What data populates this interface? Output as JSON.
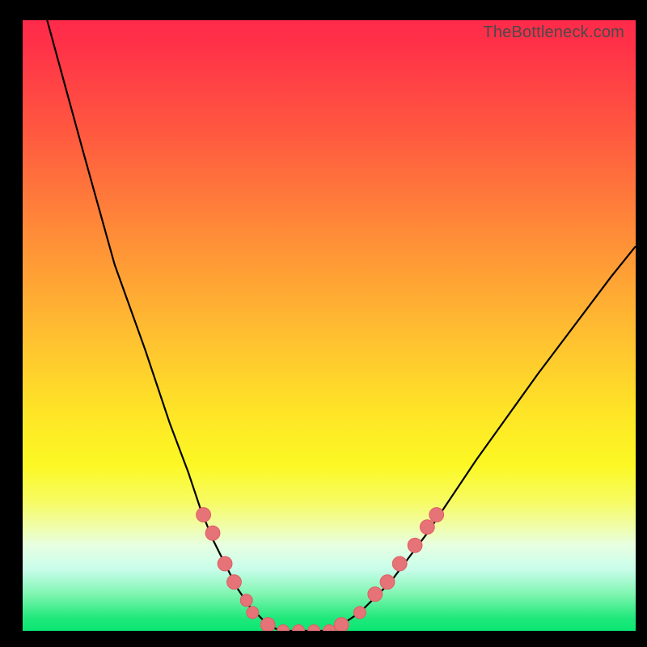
{
  "watermark": "TheBottleneck.com",
  "chart_data": {
    "type": "line",
    "title": "",
    "xlabel": "",
    "ylabel": "",
    "xlim": [
      0,
      100
    ],
    "ylim": [
      0,
      100
    ],
    "series": [
      {
        "name": "bottleneck-curve",
        "x": [
          4,
          10,
          15,
          20,
          24,
          27,
          29,
          31,
          33,
          35,
          37,
          40,
          42,
          44,
          46,
          48,
          50,
          52,
          55,
          60,
          66,
          74,
          84,
          96,
          100
        ],
        "values": [
          100,
          78,
          60,
          46,
          34,
          26,
          20,
          15,
          11,
          7,
          4,
          1,
          0,
          0,
          0,
          0,
          0,
          1,
          3,
          8,
          16,
          28,
          42,
          58,
          63
        ]
      }
    ],
    "markers": [
      {
        "series": "bottleneck-curve",
        "x": 29.5,
        "y": 19,
        "r": 1.3
      },
      {
        "series": "bottleneck-curve",
        "x": 31.0,
        "y": 16,
        "r": 1.3
      },
      {
        "series": "bottleneck-curve",
        "x": 33.0,
        "y": 11,
        "r": 1.3
      },
      {
        "series": "bottleneck-curve",
        "x": 34.5,
        "y": 8,
        "r": 1.3
      },
      {
        "series": "bottleneck-curve",
        "x": 36.5,
        "y": 5,
        "r": 1.1
      },
      {
        "series": "bottleneck-curve",
        "x": 37.5,
        "y": 3,
        "r": 1.1
      },
      {
        "series": "bottleneck-curve",
        "x": 40.0,
        "y": 1,
        "r": 1.3
      },
      {
        "series": "bottleneck-curve",
        "x": 42.5,
        "y": 0,
        "r": 1.1
      },
      {
        "series": "bottleneck-curve",
        "x": 45.0,
        "y": 0,
        "r": 1.1
      },
      {
        "series": "bottleneck-curve",
        "x": 47.5,
        "y": 0,
        "r": 1.1
      },
      {
        "series": "bottleneck-curve",
        "x": 50.0,
        "y": 0,
        "r": 1.1
      },
      {
        "series": "bottleneck-curve",
        "x": 52.0,
        "y": 1,
        "r": 1.3
      },
      {
        "series": "bottleneck-curve",
        "x": 55.0,
        "y": 3,
        "r": 1.1
      },
      {
        "series": "bottleneck-curve",
        "x": 57.5,
        "y": 6,
        "r": 1.3
      },
      {
        "series": "bottleneck-curve",
        "x": 59.5,
        "y": 8,
        "r": 1.3
      },
      {
        "series": "bottleneck-curve",
        "x": 61.5,
        "y": 11,
        "r": 1.3
      },
      {
        "series": "bottleneck-curve",
        "x": 64.0,
        "y": 14,
        "r": 1.3
      },
      {
        "series": "bottleneck-curve",
        "x": 66.0,
        "y": 17,
        "r": 1.3
      },
      {
        "series": "bottleneck-curve",
        "x": 67.5,
        "y": 19,
        "r": 1.3
      }
    ],
    "colors": {
      "curve": "#000000",
      "marker_fill": "#e57377",
      "marker_stroke": "#e15d63",
      "background_top": "#ff2a4a",
      "background_bottom": "#00e66e"
    }
  }
}
